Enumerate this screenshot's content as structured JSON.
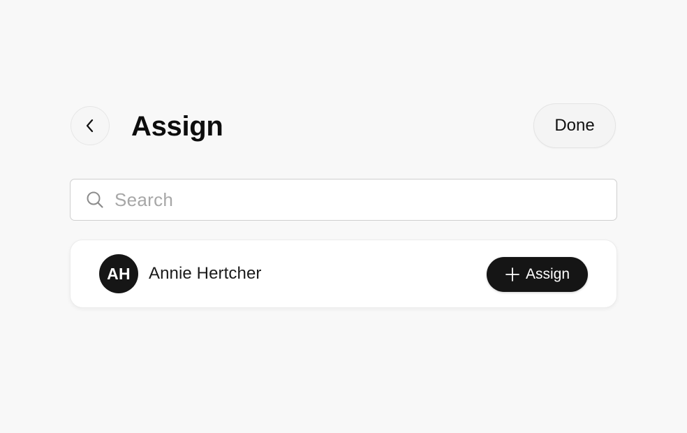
{
  "header": {
    "back_icon": "chevron-left-icon",
    "title": "Assign",
    "done_label": "Done"
  },
  "search": {
    "icon": "search-icon",
    "placeholder": "Search",
    "value": ""
  },
  "people": [
    {
      "initials": "AH",
      "name": "Annie Hertcher",
      "action_label": "Assign",
      "action_icon": "plus-icon"
    }
  ],
  "colors": {
    "background": "#f8f8f8",
    "avatar_bg": "#161616",
    "primary_button_bg": "#151515",
    "placeholder_text": "#a7a7a7"
  }
}
